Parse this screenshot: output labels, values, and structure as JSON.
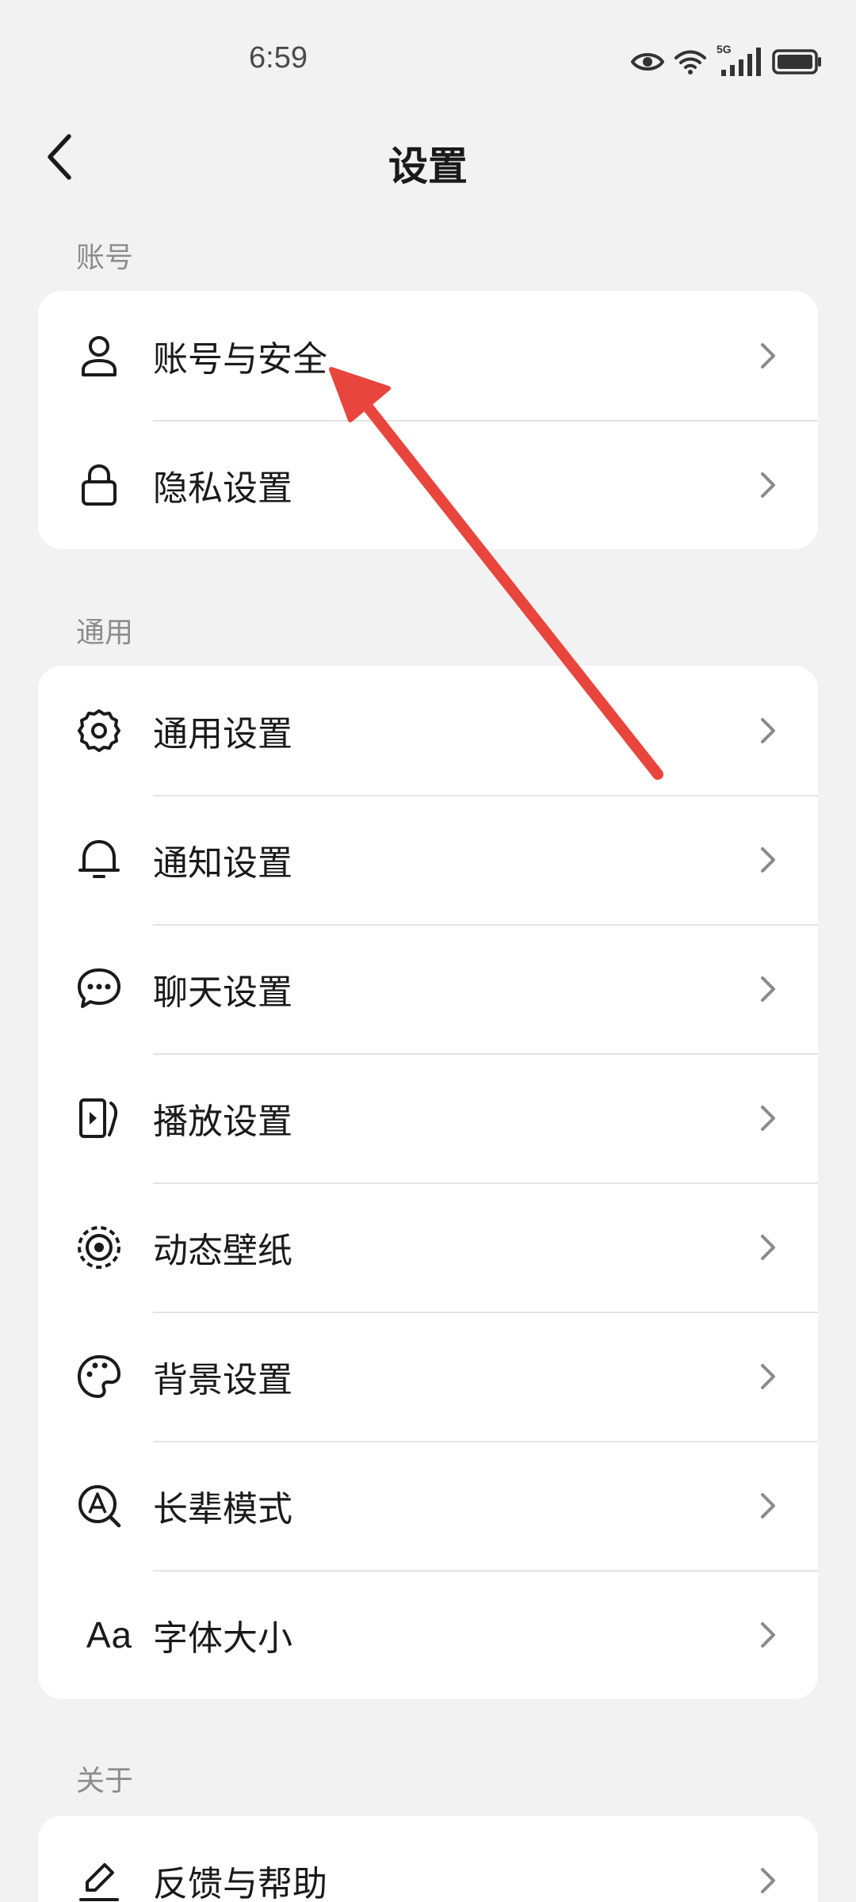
{
  "status_bar": {
    "time": "6:59",
    "icons": [
      "eye-icon",
      "wifi-icon",
      "signal-5g-icon",
      "battery-icon"
    ],
    "network_label": "5G"
  },
  "header": {
    "back_icon": "back-chevron-icon",
    "title": "设置"
  },
  "sections": [
    {
      "label": "账号",
      "items": [
        {
          "label": "账号与安全",
          "icon": "user-icon"
        },
        {
          "label": "隐私设置",
          "icon": "lock-icon"
        }
      ]
    },
    {
      "label": "通用",
      "items": [
        {
          "label": "通用设置",
          "icon": "gear-icon"
        },
        {
          "label": "通知设置",
          "icon": "bell-icon"
        },
        {
          "label": "聊天设置",
          "icon": "chat-bubble-icon"
        },
        {
          "label": "播放设置",
          "icon": "play-icon"
        },
        {
          "label": "动态壁纸",
          "icon": "live-wallpaper-icon"
        },
        {
          "label": "背景设置",
          "icon": "palette-icon"
        },
        {
          "label": "长辈模式",
          "icon": "elder-mode-icon"
        },
        {
          "label": "字体大小",
          "icon": "font-size-icon",
          "icon_text": "Aa"
        }
      ]
    },
    {
      "label": "关于",
      "items": [
        {
          "label": "反馈与帮助",
          "icon": "edit-pen-icon"
        }
      ]
    }
  ],
  "colors": {
    "background": "#f2f2f2",
    "card": "#ffffff",
    "annotation_arrow": "#e8453c"
  },
  "annotation": {
    "icon": "red-arrow-annotation"
  }
}
